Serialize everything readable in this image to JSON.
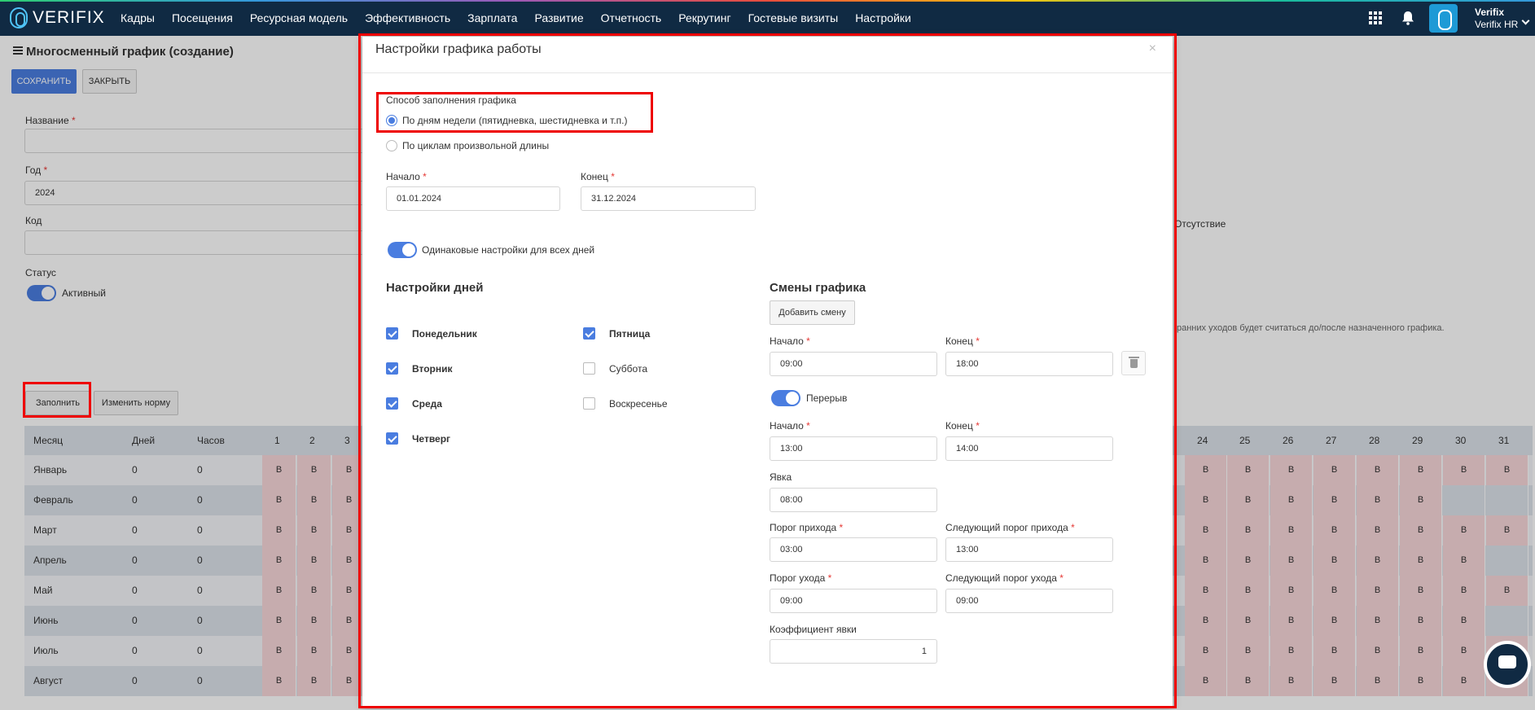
{
  "app": {
    "brand": "VERIFIX",
    "user_name": "Verifix",
    "user_org": "Verifix HR"
  },
  "nav": {
    "items": [
      "Кадры",
      "Посещения",
      "Ресурсная модель",
      "Эффективность",
      "Зарплата",
      "Развитие",
      "Отчетность",
      "Рекрутинг",
      "Гостевые визиты",
      "Настройки"
    ]
  },
  "page": {
    "title": "Многосменный график (создание)",
    "save_label": "СОХРАНИТЬ",
    "close_label": "ЗАКРЫТЬ",
    "name_label": "Название",
    "year_label": "Год",
    "year_value": "2024",
    "code_label": "Код",
    "status_label": "Статус",
    "status_value": "Активный",
    "absence_label": "Отсутствие",
    "hint_text": "ранних уходов будет считаться до/после назначенного графика.",
    "fill_button": "Заполнить",
    "change_norm_button": "Изменить норму"
  },
  "table": {
    "headers": {
      "month": "Месяц",
      "days": "Дней",
      "hours": "Часов"
    },
    "day_cols_left": [
      "1",
      "2",
      "3"
    ],
    "day_cols_right": [
      "24",
      "25",
      "26",
      "27",
      "28",
      "29",
      "30",
      "31"
    ],
    "rows": [
      {
        "month": "Январь",
        "days": "0",
        "hours": "0",
        "left": [
          "В",
          "В",
          "В"
        ],
        "right": [
          "В",
          "В",
          "В",
          "В",
          "В",
          "В",
          "В",
          "В"
        ]
      },
      {
        "month": "Февраль",
        "days": "0",
        "hours": "0",
        "left": [
          "В",
          "В",
          "В"
        ],
        "right": [
          "В",
          "В",
          "В",
          "В",
          "В",
          "В",
          "",
          ""
        ]
      },
      {
        "month": "Март",
        "days": "0",
        "hours": "0",
        "left": [
          "В",
          "В",
          "В"
        ],
        "right": [
          "В",
          "В",
          "В",
          "В",
          "В",
          "В",
          "В",
          "В"
        ]
      },
      {
        "month": "Апрель",
        "days": "0",
        "hours": "0",
        "left": [
          "В",
          "В",
          "В"
        ],
        "right": [
          "В",
          "В",
          "В",
          "В",
          "В",
          "В",
          "В",
          ""
        ]
      },
      {
        "month": "Май",
        "days": "0",
        "hours": "0",
        "left": [
          "В",
          "В",
          "В"
        ],
        "right": [
          "В",
          "В",
          "В",
          "В",
          "В",
          "В",
          "В",
          "В"
        ]
      },
      {
        "month": "Июнь",
        "days": "0",
        "hours": "0",
        "left": [
          "В",
          "В",
          "В"
        ],
        "right": [
          "В",
          "В",
          "В",
          "В",
          "В",
          "В",
          "В",
          ""
        ]
      },
      {
        "month": "Июль",
        "days": "0",
        "hours": "0",
        "left": [
          "В",
          "В",
          "В"
        ],
        "right": [
          "В",
          "В",
          "В",
          "В",
          "В",
          "В",
          "В",
          "В"
        ]
      },
      {
        "month": "Август",
        "days": "0",
        "hours": "0",
        "left": [
          "В",
          "В",
          "В"
        ],
        "right": [
          "В",
          "В",
          "В",
          "В",
          "В",
          "В",
          "В",
          "В"
        ]
      }
    ]
  },
  "modal": {
    "title": "Настройки графика работы",
    "close_glyph": "×",
    "fill_method_label": "Способ заполнения графика",
    "option_weekdays": "По дням недели (пятидневка, шестидневка и т.п.)",
    "option_cycles": "По циклам произвольной длины",
    "start_label": "Начало",
    "start_value": "01.01.2024",
    "end_label": "Конец",
    "end_value": "31.12.2024",
    "same_settings_label": "Одинаковые настройки для всех дней",
    "days_settings_title": "Настройки дней",
    "days": [
      {
        "label": "Понедельник",
        "checked": true
      },
      {
        "label": "Вторник",
        "checked": true
      },
      {
        "label": "Среда",
        "checked": true
      },
      {
        "label": "Четверг",
        "checked": true
      },
      {
        "label": "Пятница",
        "checked": true
      },
      {
        "label": "Суббота",
        "checked": false
      },
      {
        "label": "Воскресенье",
        "checked": false
      }
    ],
    "shifts_title": "Смены графика",
    "add_shift_button": "Добавить смену",
    "shift_start_label": "Начало",
    "shift_start_value": "09:00",
    "shift_end_label": "Конец",
    "shift_end_value": "18:00",
    "break_label": "Перерыв",
    "break_start_label": "Начало",
    "break_start_value": "13:00",
    "break_end_label": "Конец",
    "break_end_value": "14:00",
    "presence_label": "Явка",
    "presence_value": "08:00",
    "arrival_threshold_label": "Порог прихода",
    "arrival_threshold_value": "03:00",
    "next_arrival_threshold_label": "Следующий порог прихода",
    "next_arrival_threshold_value": "13:00",
    "leave_threshold_label": "Порог ухода",
    "leave_threshold_value": "09:00",
    "next_leave_threshold_label": "Следующий порог ухода",
    "next_leave_threshold_value": "09:00",
    "presence_coef_label": "Коэффициент явки",
    "presence_coef_value": "1"
  }
}
